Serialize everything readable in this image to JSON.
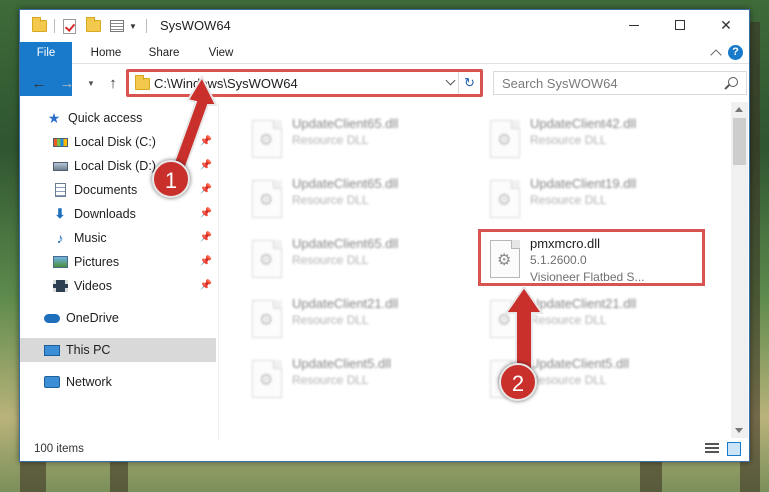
{
  "window": {
    "title": "SysWOW64"
  },
  "ribbon": {
    "tabs": [
      "File",
      "Home",
      "Share",
      "View"
    ],
    "help": "?"
  },
  "navbar": {
    "address": "C:\\Windows\\SysWOW64",
    "search_placeholder": "Search SysWOW64",
    "refresh": "↻"
  },
  "sidebar": {
    "items": [
      {
        "label": "Quick access",
        "icon": "star-icon",
        "pinned": false
      },
      {
        "label": "Local Disk (C:)",
        "icon": "drive-icon",
        "pinned": true
      },
      {
        "label": "Local Disk (D:)",
        "icon": "drive-icon",
        "pinned": true
      },
      {
        "label": "Documents",
        "icon": "documents-icon",
        "pinned": true
      },
      {
        "label": "Downloads",
        "icon": "downloads-icon",
        "pinned": true
      },
      {
        "label": "Music",
        "icon": "music-icon",
        "pinned": true
      },
      {
        "label": "Pictures",
        "icon": "pictures-icon",
        "pinned": true
      },
      {
        "label": "Videos",
        "icon": "videos-icon",
        "pinned": true
      },
      {
        "label": "OneDrive",
        "icon": "onedrive-icon",
        "pinned": false
      },
      {
        "label": "This PC",
        "icon": "this-pc-icon",
        "pinned": false,
        "selected": true
      },
      {
        "label": "Network",
        "icon": "network-icon",
        "pinned": false
      }
    ]
  },
  "files": {
    "left": [
      {
        "name": "UpdateClient65.dll",
        "desc": "Resource DLL"
      },
      {
        "name": "UpdateClient65.dll",
        "desc": "Resource DLL"
      },
      {
        "name": "UpdateClient65.dll",
        "desc": "Resource DLL"
      },
      {
        "name": "UpdateClient21.dll",
        "desc": "Resource DLL"
      },
      {
        "name": "UpdateClient5.dll",
        "desc": "Resource DLL"
      }
    ],
    "right": [
      {
        "name": "UpdateClient42.dll",
        "desc": "Resource DLL"
      },
      {
        "name": "UpdateClient19.dll",
        "desc": "Resource DLL"
      },
      {
        "name": "UpdateClient21.dll",
        "desc": "Resource DLL"
      },
      {
        "name": "UpdateClient5.dll",
        "desc": "Resource DLL"
      }
    ],
    "highlighted": {
      "name": "pmxmcro.dll",
      "version": "5.1.2600.0",
      "desc": "Visioneer Flatbed S..."
    }
  },
  "status": {
    "items_count": "100 items"
  },
  "annotations": {
    "step1": "1",
    "step2": "2",
    "color": "#c9302c"
  }
}
